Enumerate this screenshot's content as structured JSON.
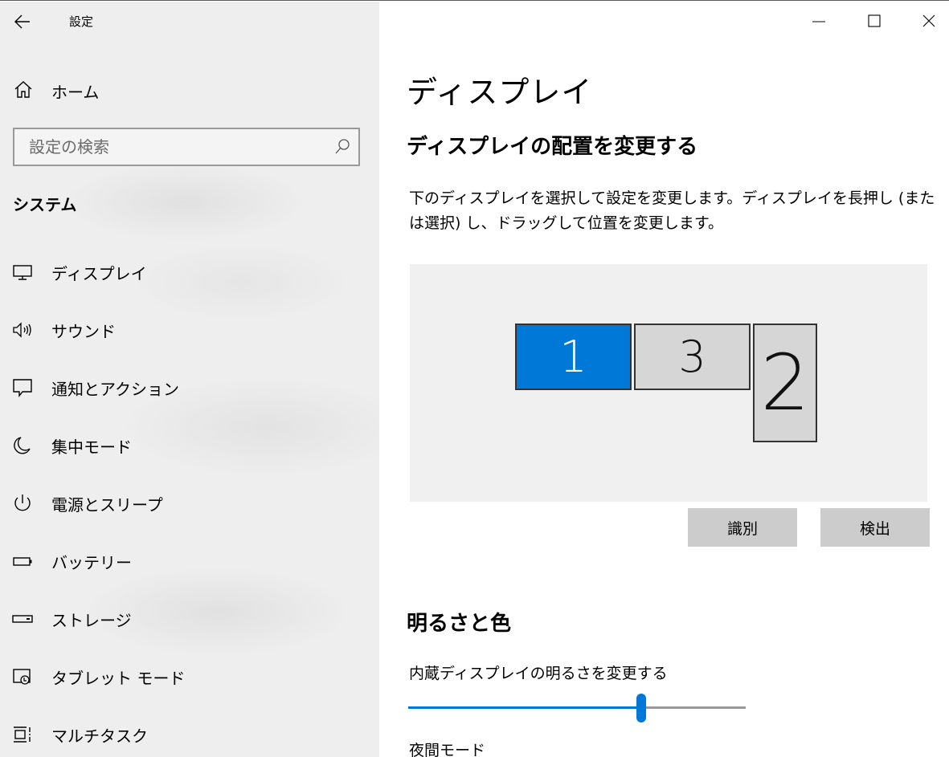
{
  "window": {
    "title": "設定",
    "controls": {
      "minimize": "minimize-icon",
      "maximize": "maximize-icon",
      "close": "close-icon"
    }
  },
  "sidebar": {
    "home_label": "ホーム",
    "search_placeholder": "設定の検索",
    "search_value": "",
    "section_title": "システム",
    "items": [
      {
        "label": "ディスプレイ",
        "icon": "monitor-icon"
      },
      {
        "label": "サウンド",
        "icon": "speaker-icon"
      },
      {
        "label": "通知とアクション",
        "icon": "notification-icon"
      },
      {
        "label": "集中モード",
        "icon": "moon-icon"
      },
      {
        "label": "電源とスリープ",
        "icon": "power-icon"
      },
      {
        "label": "バッテリー",
        "icon": "battery-icon"
      },
      {
        "label": "ストレージ",
        "icon": "storage-icon"
      },
      {
        "label": "タブレット モード",
        "icon": "tablet-icon"
      },
      {
        "label": "マルチタスク",
        "icon": "multitask-icon"
      }
    ]
  },
  "main": {
    "page_title": "ディスプレイ",
    "arrangement_heading": "ディスプレイの配置を変更する",
    "arrangement_description": "下のディスプレイを選択して設定を変更します。ディスプレイを長押し (または選択) し、ドラッグして位置を変更します。",
    "monitors": [
      {
        "number": "1",
        "selected": true
      },
      {
        "number": "3",
        "selected": false
      },
      {
        "number": "2",
        "selected": false
      }
    ],
    "identify_button": "識別",
    "detect_button": "検出",
    "brightness_heading": "明るさと色",
    "brightness_label": "内蔵ディスプレイの明るさを変更する",
    "brightness_value": 0.69,
    "night_mode_label": "夜間モード"
  },
  "colors": {
    "accent": "#0078d7",
    "sidebar_bg": "#eeeeee",
    "button_bg": "#cccccc",
    "arrangement_bg": "#f0f0f0"
  }
}
